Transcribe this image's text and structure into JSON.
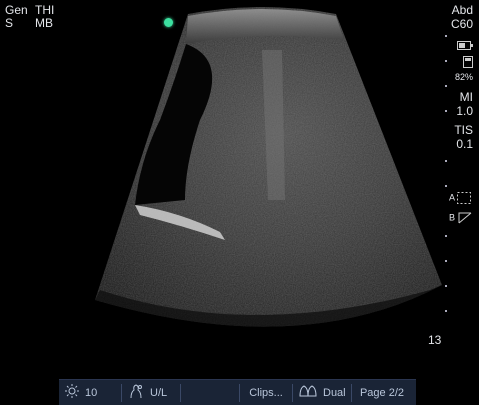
{
  "header": {
    "mode_left_line1": "Gen",
    "mode_left_line2": "S",
    "mode_right_line1": "THI",
    "mode_right_line2": "MB"
  },
  "right_panel": {
    "preset": "Abd",
    "probe": "C60",
    "battery_icon": "battery-icon",
    "storage_icon": "storage-icon",
    "storage_percent": "82%",
    "mi_label": "MI",
    "mi_value": "1.0",
    "tis_label": "TIS",
    "tis_value": "0.1",
    "marker_a": "A",
    "marker_b": "B"
  },
  "depth": "13",
  "toolbar": {
    "brightness_icon": "brightness-icon",
    "gain_value": "10",
    "profile_icon": "profile-icon",
    "ul_label": "U/L",
    "clips_label": "Clips...",
    "dual_icon": "dual-icon",
    "dual_label": "Dual",
    "page_label": "Page 2/2"
  },
  "colors": {
    "orientation_marker": "#3ce0a0",
    "toolbar_bg": "#1a2436"
  }
}
